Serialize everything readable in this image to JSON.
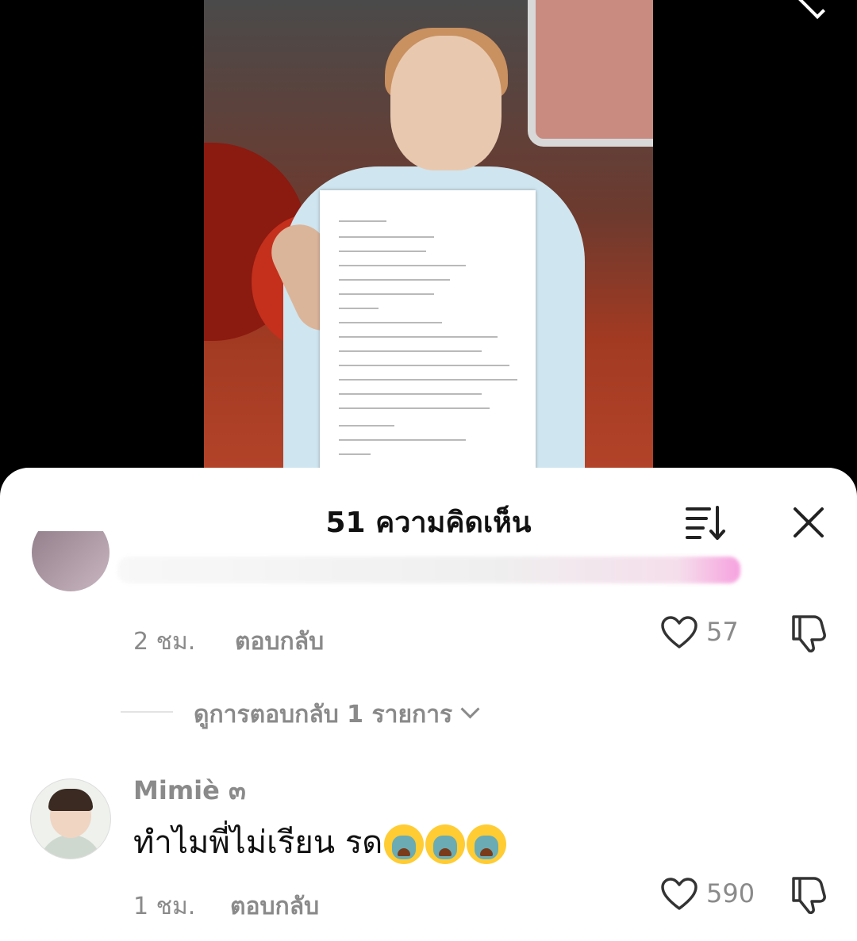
{
  "sheet": {
    "title": "51 ความคิดเห็น"
  },
  "comments": [
    {
      "time": "2 ชม.",
      "reply_label": "ตอบกลับ",
      "likes": "57"
    },
    {
      "username": "Mimiè ๓",
      "text": "ทำไมพี่ไม่เรียน รด",
      "emoji": "loudly-crying-face",
      "emoji_count": 3,
      "time": "1 ชม.",
      "reply_label": "ตอบกลับ",
      "likes": "590"
    }
  ],
  "view_replies": {
    "label": "ดูการตอบกลับ 1 รายการ"
  },
  "colors": {
    "sheet_bg": "#ffffff",
    "muted_text": "#8a8a8a",
    "title_text": "#111111"
  }
}
